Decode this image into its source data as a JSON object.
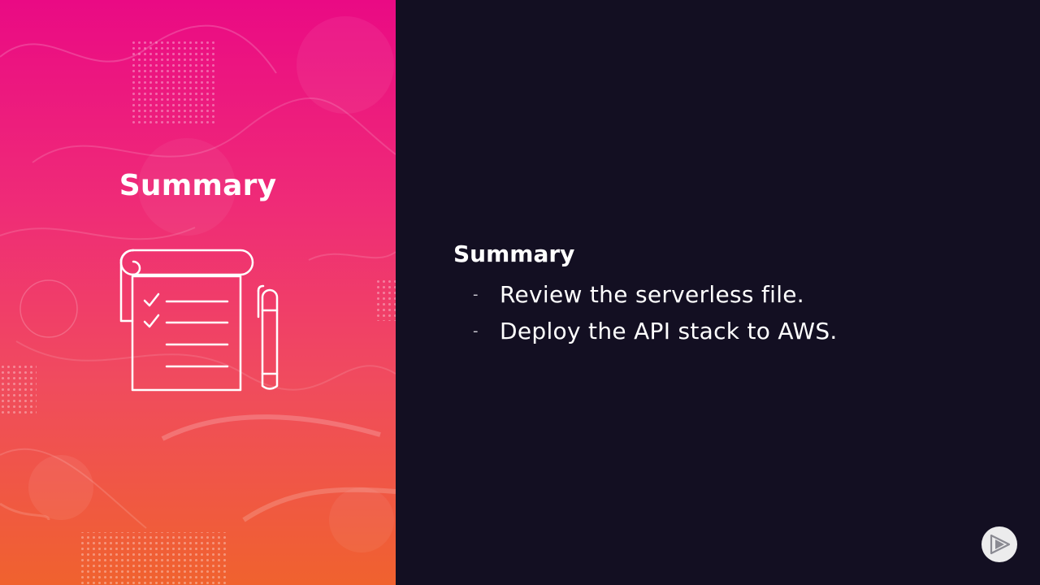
{
  "left_panel": {
    "title": "Summary",
    "icon": "notepad-checklist-icon"
  },
  "content": {
    "heading": "Summary",
    "bullets": [
      {
        "marker": "-",
        "text": "Review the serverless file."
      },
      {
        "marker": "-",
        "text": "Deploy the API stack to AWS."
      }
    ]
  },
  "logo": {
    "icon": "play-logo-icon"
  },
  "colors": {
    "gradient_top": "#ea0a84",
    "gradient_bottom": "#f0622e",
    "background": "#130f22",
    "text": "#ffffff"
  }
}
